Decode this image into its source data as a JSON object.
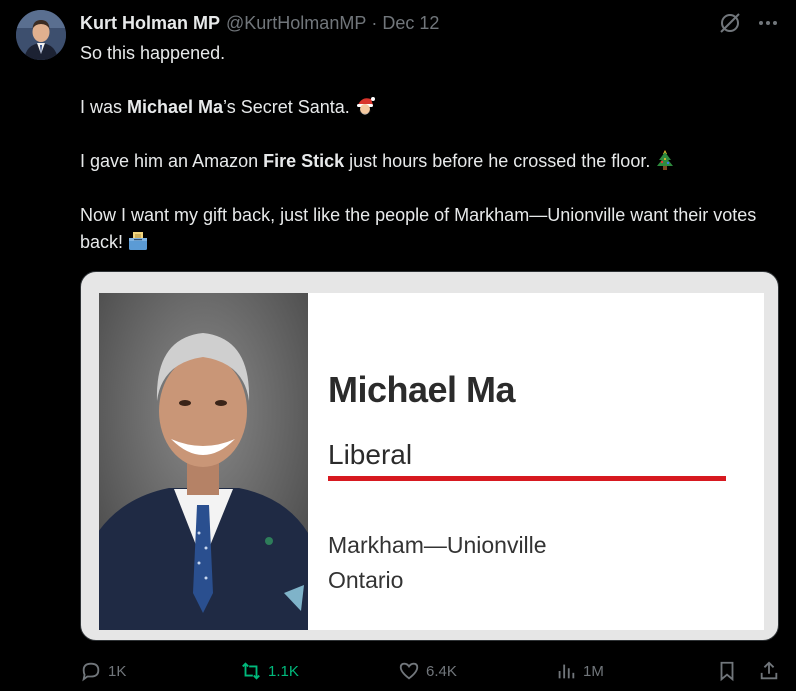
{
  "author": {
    "name": "Kurt Holman MP",
    "handle": "@KurtHolmanMP",
    "separator": "·",
    "date": "Dec 12"
  },
  "tweet": {
    "line1": "So this happened.",
    "line2_pre": "I was ",
    "line2_bold": "Michael Ma",
    "line2_post": "’s Secret Santa.",
    "line3_pre": "I gave him an Amazon ",
    "line3_bold": "Fire Stick",
    "line3_post": " just hours before he crossed the floor.",
    "line4": "Now I want my gift back, just like the people of Markham—Unionville want their votes back!",
    "emojis": [
      "santa-emoji",
      "christmas-tree-emoji",
      "ballot-box-emoji"
    ]
  },
  "media_card": {
    "name": "Michael Ma",
    "party": "Liberal",
    "riding": "Markham—Unionville",
    "province": "Ontario",
    "party_color": "#d71920"
  },
  "actions": {
    "replies": "1K",
    "retweets": "1.1K",
    "likes": "6.4K",
    "views": "1M"
  },
  "colors": {
    "background": "#000000",
    "text": "#e7e9ea",
    "muted": "#71767b",
    "retweet_active": "#00ba7c"
  }
}
